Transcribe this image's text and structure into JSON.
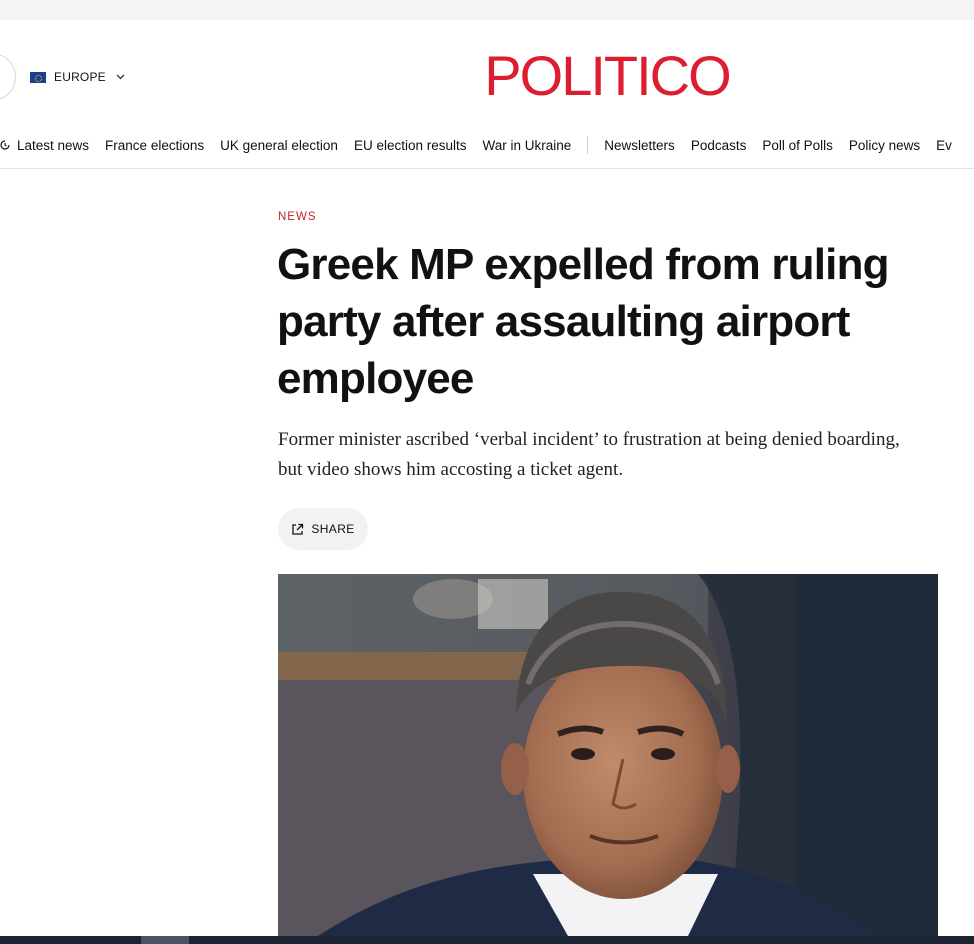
{
  "brand": {
    "logo_text": "POLITICO",
    "accent_color": "#dc1e30"
  },
  "edition": {
    "label": "EUROPE",
    "flag_icon": "eu-flag-icon",
    "chevron_icon": "chevron-down-icon"
  },
  "nav": {
    "items": [
      {
        "label": "Latest news",
        "icon": "live-icon"
      },
      {
        "label": "France elections"
      },
      {
        "label": "UK general election"
      },
      {
        "label": "EU election results"
      },
      {
        "label": "War in Ukraine"
      },
      {
        "label": "Newsletters"
      },
      {
        "label": "Podcasts"
      },
      {
        "label": "Poll of Polls"
      },
      {
        "label": "Policy news"
      },
      {
        "label": "Ev"
      }
    ]
  },
  "article": {
    "kicker": "NEWS",
    "headline": "Greek MP expelled from ruling party after assaulting airport employee",
    "dek": "Former minister ascribed ‘verbal incident’ to frustration at being denied boarding, but video shows him accosting a ticket agent.",
    "share_label": "SHARE",
    "share_icon": "external-share-icon"
  },
  "colors": {
    "kicker": "#c0252c",
    "bottom_bar": "#1b2433"
  }
}
